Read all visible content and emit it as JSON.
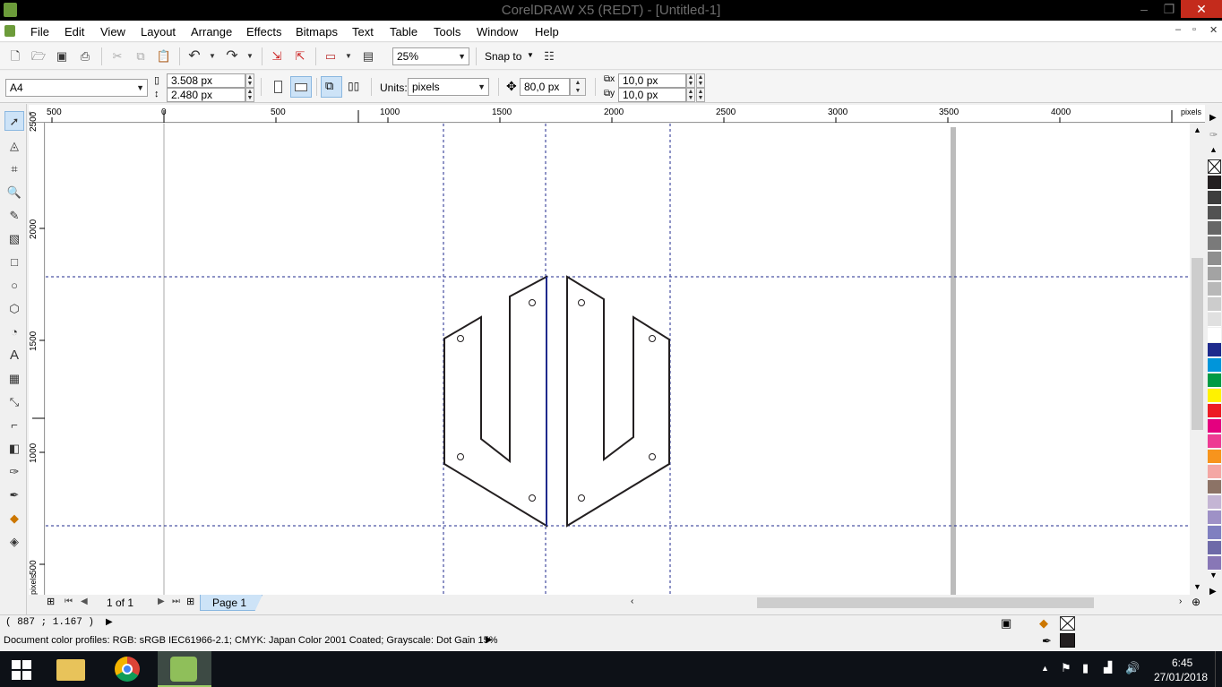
{
  "window": {
    "title": "CorelDRAW X5 (REDT) - [Untitled-1]",
    "minimize": "–",
    "restore": "❐",
    "close": "✕"
  },
  "menu": [
    "File",
    "Edit",
    "View",
    "Layout",
    "Arrange",
    "Effects",
    "Bitmaps",
    "Text",
    "Table",
    "Tools",
    "Window",
    "Help"
  ],
  "doc_controls": {
    "minimize": "–",
    "restore": "▫",
    "close": "✕"
  },
  "toolbar": {
    "zoom": "25%",
    "snap_to": "Snap to"
  },
  "property_bar": {
    "page_size": "A4",
    "width": "3.508 px",
    "height": "2.480 px",
    "units_label": "Units:",
    "units": "pixels",
    "nudge": "80,0 px",
    "dup_x": "10,0 px",
    "dup_y": "10,0 px"
  },
  "rulers": {
    "h_labels": [
      "500",
      "0",
      "500",
      "1000",
      "1500",
      "2000",
      "2500",
      "3000",
      "3500",
      "4000"
    ],
    "h_unit": "pixels",
    "v_labels": [
      "2500",
      "2000",
      "1500",
      "1000",
      "500"
    ],
    "v_unit": "pixels"
  },
  "page_nav": {
    "counter": "1 of 1",
    "page_tab": "Page 1"
  },
  "status": {
    "coords": "( 887  ; 1.167 )",
    "profiles": "Document color profiles: RGB: sRGB IEC61966-2.1; CMYK: Japan Color 2001 Coated; Grayscale: Dot Gain 15%"
  },
  "palette": [
    "#231f20",
    "#3d3d3d",
    "#525252",
    "#666666",
    "#7a7a7a",
    "#8f8f8f",
    "#a3a3a3",
    "#b8b8b8",
    "#cccccc",
    "#e0e0e0",
    "#ffffff",
    "#1e2a8c",
    "#0095da",
    "#009a44",
    "#fff200",
    "#ed1c24",
    "#e4007f",
    "#ee3b93",
    "#f7941d",
    "#f4a7a4",
    "#8c7366",
    "#c4b5d4",
    "#9e91c6",
    "#7f7fc0",
    "#6e6aa8",
    "#8877b6"
  ],
  "taskbar": {
    "time": "6:45",
    "date": "27/01/2018"
  }
}
